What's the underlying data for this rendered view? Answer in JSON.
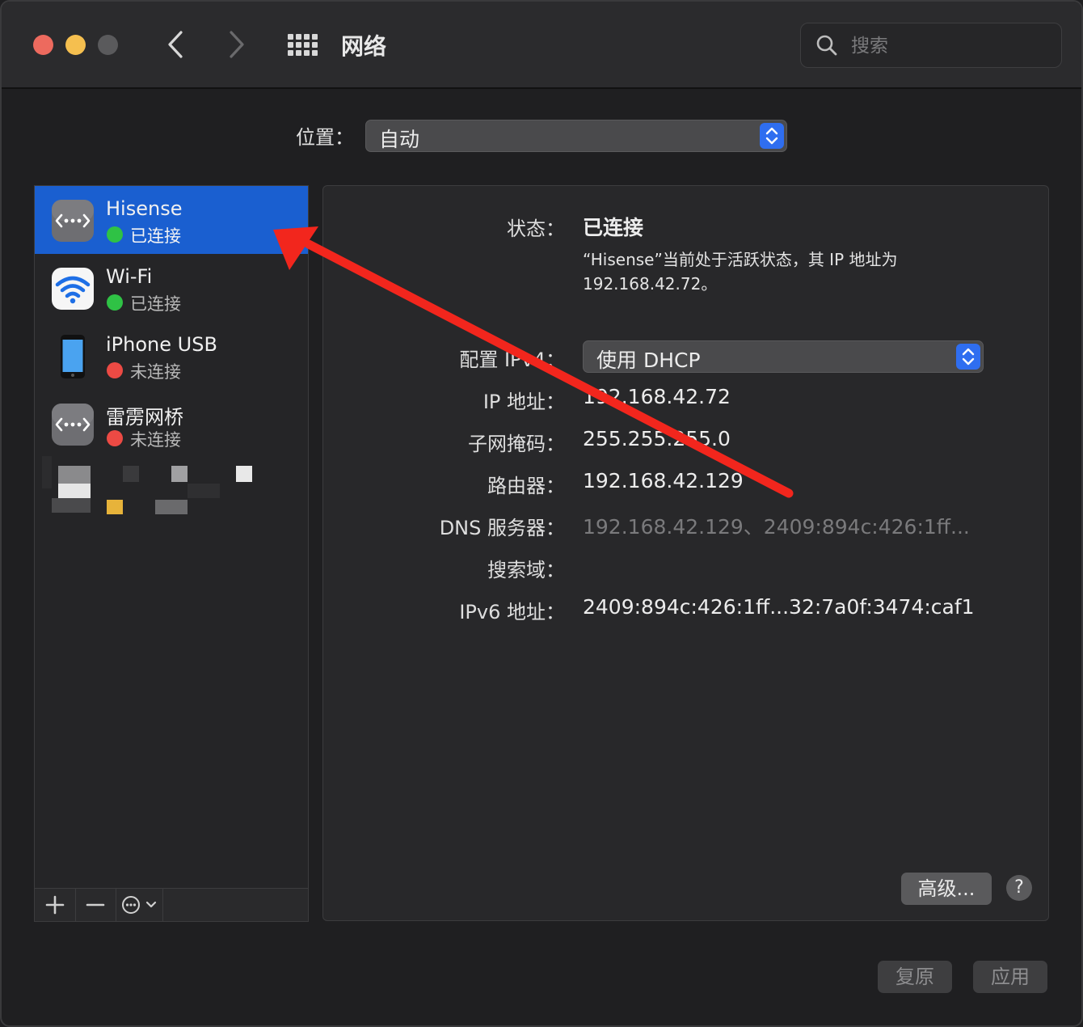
{
  "window": {
    "title": "网络"
  },
  "search": {
    "placeholder": "搜索"
  },
  "location": {
    "label": "位置：",
    "value": "自动"
  },
  "services": [
    {
      "name": "Hisense",
      "status": "已连接",
      "status_color": "#2fc245",
      "icon": "ethernet-icon",
      "selected": true
    },
    {
      "name": "Wi-Fi",
      "status": "已连接",
      "status_color": "#2fc245",
      "icon": "wifi-icon",
      "selected": false
    },
    {
      "name": "iPhone USB",
      "status": "未连接",
      "status_color": "#ec4a44",
      "icon": "iphone-icon",
      "selected": false
    },
    {
      "name": "雷雳网桥",
      "status": "未连接",
      "status_color": "#ec4a44",
      "icon": "ethernet-icon",
      "selected": false
    }
  ],
  "sidebar_tools": {
    "add": "+",
    "remove": "−"
  },
  "detail": {
    "status_label": "状态：",
    "status_value": "已连接",
    "status_desc": "“Hisense”当前处于活跃状态，其 IP 地址为 192.168.42.72。",
    "config_label": "配置 IPv4：",
    "config_value": "使用 DHCP",
    "ip_label": "IP 地址：",
    "ip_value": "192.168.42.72",
    "subnet_label": "子网掩码：",
    "subnet_value": "255.255.255.0",
    "router_label": "路由器：",
    "router_value": "192.168.42.129",
    "dns_label": "DNS 服务器：",
    "dns_value": "192.168.42.129、2409:894c:426:1ff...",
    "search_domain_label": "搜索域：",
    "ipv6_label": "IPv6 地址：",
    "ipv6_value": "2409:894c:426:1ff...32:7a0f:3474:caf1"
  },
  "buttons": {
    "advanced": "高级...",
    "help": "?",
    "revert": "复原",
    "apply": "应用"
  },
  "colors": {
    "accent": "#1a5fd0",
    "annotation_arrow": "#f2261d"
  }
}
